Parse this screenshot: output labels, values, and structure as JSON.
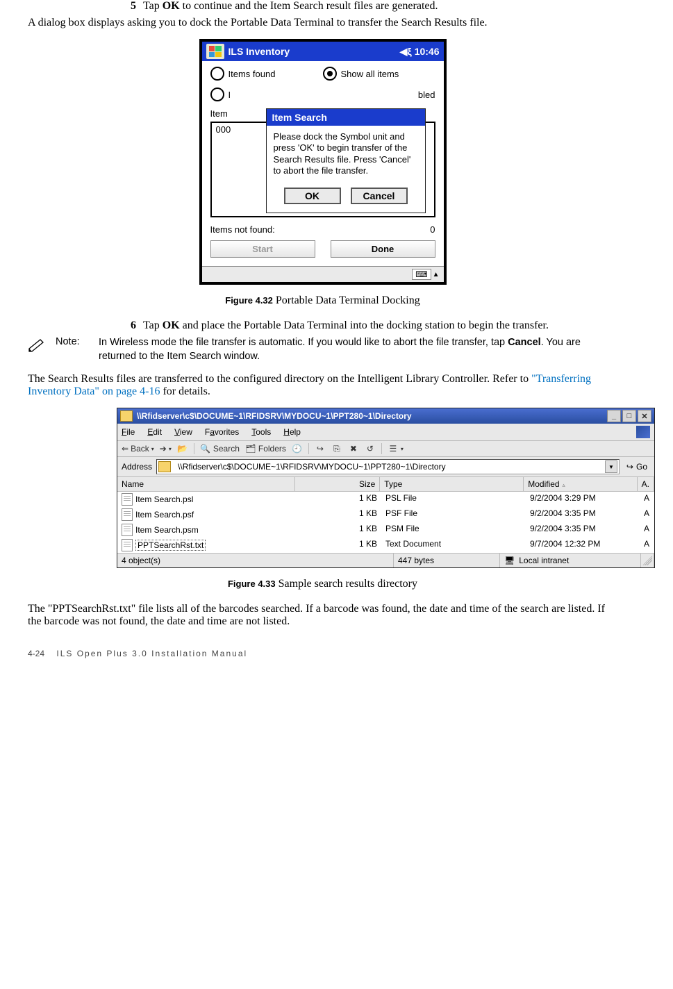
{
  "step5": {
    "num": "5",
    "text_a": "Tap ",
    "text_b": "OK",
    "text_c": " to continue and the Item Search result files are generated."
  },
  "para_after_step5": "A dialog box displays asking you to dock the Portable Data Terminal to transfer the Search Results file.",
  "pda": {
    "title": "ILS Inventory",
    "clock": "10:46",
    "radio_left": "Items found",
    "radio_right": "Show all items",
    "radio_left2_partial": "I",
    "radio_right2_partial": "bled",
    "item_label": "Item",
    "item_value": "000",
    "items_not_found_label": "Items not found:",
    "items_not_found_value": "0",
    "btn_start": "Start",
    "btn_done": "Done",
    "dialog": {
      "title": "Item Search",
      "body": "Please dock the Symbol unit and press 'OK' to begin transfer of the Search Results file. Press 'Cancel' to abort the file transfer.",
      "ok": "OK",
      "cancel": "Cancel"
    }
  },
  "fig432": {
    "label": "Figure 4.32",
    "caption": " Portable Data Terminal Docking"
  },
  "step6": {
    "num": "6",
    "text_a": "Tap ",
    "text_b": "OK",
    "text_c": " and place the Portable Data Terminal into the docking station to begin the transfer."
  },
  "note": {
    "label": "Note:",
    "text_a": "In Wireless mode the file transfer is automatic. If you would like to abort the file transfer, tap ",
    "text_b": "Cancel",
    "text_c": ". You are returned to the Item Search window."
  },
  "para_after_note_a": "The Search Results files are transferred to the configured directory on the Intelligent Library Controller. Refer to ",
  "para_after_note_link": "\"Transferring Inventory Data\" on page 4-16",
  "para_after_note_b": " for details.",
  "explorer": {
    "title": "\\\\Rfidserver\\c$\\DOCUME~1\\RFIDSRV\\MYDOCU~1\\PPT280~1\\Directory",
    "menu": [
      "File",
      "Edit",
      "View",
      "Favorites",
      "Tools",
      "Help"
    ],
    "back": "Back",
    "search": "Search",
    "folders": "Folders",
    "address_label": "Address",
    "address_value": "\\\\Rfidserver\\c$\\DOCUME~1\\RFIDSRV\\MYDOCU~1\\PPT280~1\\Directory",
    "go": "Go",
    "headers": {
      "name": "Name",
      "size": "Size",
      "type": "Type",
      "modified": "Modified",
      "a": "A."
    },
    "rows": [
      {
        "name": "Item Search.psl",
        "size": "1 KB",
        "type": "PSL File",
        "modified": "9/2/2004 3:29 PM",
        "a": "A",
        "selected": false
      },
      {
        "name": "Item Search.psf",
        "size": "1 KB",
        "type": "PSF File",
        "modified": "9/2/2004 3:35 PM",
        "a": "A",
        "selected": false
      },
      {
        "name": "Item Search.psm",
        "size": "1 KB",
        "type": "PSM File",
        "modified": "9/2/2004 3:35 PM",
        "a": "A",
        "selected": false
      },
      {
        "name": "PPTSearchRst.txt",
        "size": "1 KB",
        "type": "Text Document",
        "modified": "9/7/2004 12:32 PM",
        "a": "A",
        "selected": true
      }
    ],
    "status_left": "4 object(s)",
    "status_mid": "447 bytes",
    "status_right": "Local intranet"
  },
  "fig433": {
    "label": "Figure 4.33",
    "caption": " Sample search results directory"
  },
  "final_para": "The \"PPTSearchRst.txt\" file lists all of the barcodes searched. If a barcode was found, the date and time of the search are listed. If the barcode was not found, the date and time are not listed.",
  "footer": {
    "page": "4-24",
    "book": "ILS Open Plus 3.0 Installation Manual"
  }
}
